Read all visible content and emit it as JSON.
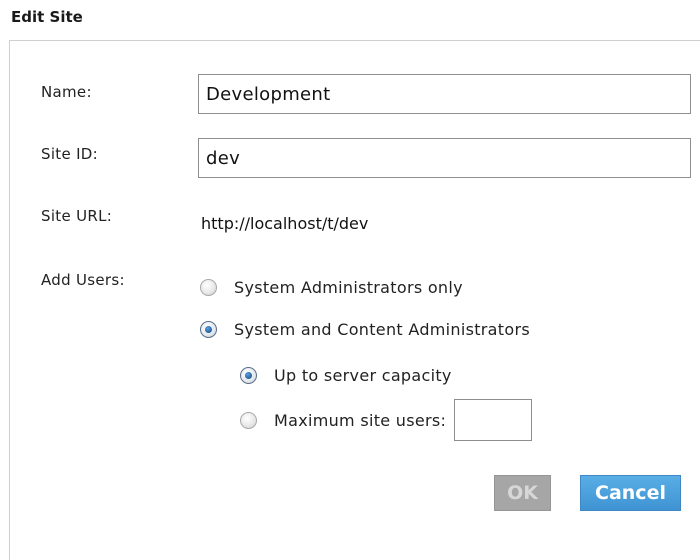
{
  "dialog": {
    "title": "Edit Site"
  },
  "form": {
    "name_label": "Name:",
    "name_value": "Development",
    "site_id_label": "Site ID:",
    "site_id_value": "dev",
    "site_url_label": "Site URL:",
    "site_url_value": "http://localhost/t/dev",
    "add_users_label": "Add Users:",
    "add_users_options": [
      {
        "label": "System Administrators only",
        "checked": false
      },
      {
        "label": "System and Content Administrators",
        "checked": true
      }
    ],
    "capacity_options": [
      {
        "label": "Up to server capacity",
        "checked": true
      },
      {
        "label": "Maximum site users:",
        "checked": false
      }
    ],
    "max_users_value": ""
  },
  "buttons": {
    "ok_label": "OK",
    "ok_enabled": false,
    "cancel_label": "Cancel"
  },
  "colors": {
    "cancel_button": "#4a9fdc",
    "ok_button_disabled": "#a6a6a6",
    "radio_selected": "#1f5f9e"
  },
  "icons": {
    "radio_unchecked": "radio-unchecked-icon",
    "radio_checked": "radio-checked-icon"
  }
}
